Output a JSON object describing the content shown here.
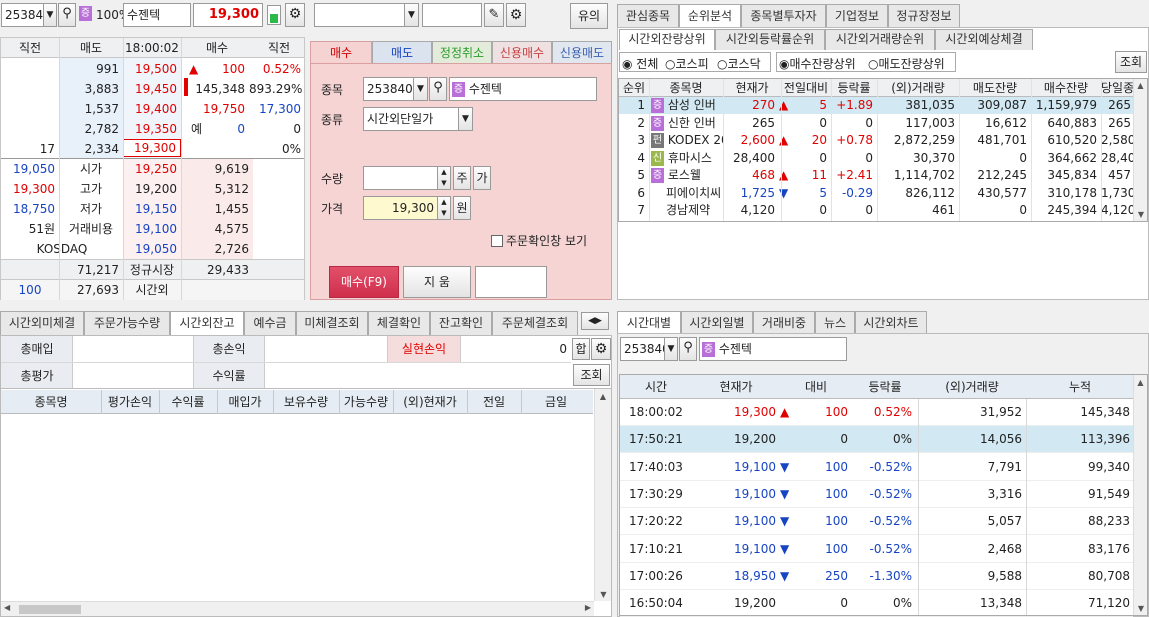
{
  "quote": {
    "code": "253840",
    "badge": "증",
    "zoom": "100%",
    "name": "수젠텍",
    "price": "19,300"
  },
  "order_top": {
    "notice_button": "유의"
  },
  "orderbook": {
    "headers": [
      "직전",
      "매도",
      "18:00:02",
      "매수",
      "직전"
    ],
    "asks": [
      {
        "qty": "991",
        "price": "19,500"
      },
      {
        "qty": "3,883",
        "price": "19,450"
      },
      {
        "qty": "1,537",
        "price": "19,400"
      },
      {
        "qty": "2,782",
        "price": "19,350"
      },
      {
        "prev": "17",
        "qty": "2,334",
        "price": "19,300"
      }
    ],
    "side_info": [
      {
        "arrow": "▲",
        "val": "100",
        "pct": "0.52%"
      },
      {
        "val": "145,348",
        "pct": "893.29%"
      },
      {
        "val": "19,750",
        "pct": "17,300"
      },
      {
        "label": "예",
        "val": "0",
        "pct": "0"
      },
      {
        "pct": "0%"
      }
    ],
    "bids": [
      {
        "price": "19,250",
        "qty": "9,619"
      },
      {
        "price": "19,200",
        "qty": "5,312"
      },
      {
        "price": "19,150",
        "qty": "1,455"
      },
      {
        "price": "19,100",
        "qty": "4,575"
      },
      {
        "price": "19,050",
        "qty": "2,726"
      }
    ],
    "left_info": [
      {
        "val": "19,050",
        "label": "시가"
      },
      {
        "val": "19,300",
        "label": "고가"
      },
      {
        "val": "18,750",
        "label": "저가"
      },
      {
        "val": "51원",
        "label": "거래비용"
      },
      {
        "val": "",
        "label": "KOSDAQ"
      }
    ],
    "total_ask": "71,217",
    "session": "정규시장",
    "total_bid": "29,433",
    "after_left": "100",
    "after_ask": "27,693",
    "after_label": "시간외"
  },
  "order_form": {
    "tabs": [
      "매수",
      "매도",
      "정정취소",
      "신용매수",
      "신용매도"
    ],
    "labels": {
      "stock": "종목",
      "kind": "종류",
      "qty": "수량",
      "price": "가격"
    },
    "code": "253840",
    "badge": "증",
    "name": "수젠텍",
    "kind": "시간외단일가",
    "price": "19,300",
    "unit_share": "주",
    "unit_ga": "가",
    "unit_won": "원",
    "confirm_label": "주문확인창 보기",
    "buy_button": "매수(F9)",
    "clear_button": "지 움"
  },
  "bottom_left": {
    "tabs": [
      "시간외미체결",
      "주문가능수량",
      "시간외잔고",
      "예수금",
      "미체결조회",
      "체결확인",
      "잔고확인",
      "주문체결조회"
    ],
    "labels": {
      "total_buy": "총매입",
      "total_eval": "총평가",
      "total_pl": "총손익",
      "profit_rate": "수익률",
      "realized": "실현손익"
    },
    "realized_value": "0",
    "sum_button": "합",
    "query_button": "조회",
    "columns": [
      "종목명",
      "평가손익",
      "수익률",
      "매입가",
      "보유수량",
      "가능수량",
      "(외)현재가",
      "전일",
      "금일"
    ]
  },
  "ranking": {
    "tabs": [
      "관심종목",
      "순위분석",
      "종목별투자자",
      "기업정보",
      "정규장정보"
    ],
    "subtabs": [
      "시간외잔량상위",
      "시간외등락률순위",
      "시간외거래량순위",
      "시간외예상체결"
    ],
    "market_filters": [
      "전체",
      "코스피",
      "코스닥"
    ],
    "sort_filters": [
      "매수잔량상위",
      "매도잔량상위"
    ],
    "query_button": "조회",
    "columns": [
      "순위",
      "종목명",
      "현재가",
      "전일대비",
      "등락률",
      "(외)거래량",
      "매도잔량",
      "매수잔량",
      "당일종가"
    ],
    "rows": [
      {
        "rank": "1",
        "badge": "증",
        "name": "삼성 인버",
        "price": "270",
        "arrow": "▲",
        "change": "5",
        "rate": "+1.89",
        "volume": "381,035",
        "ask": "309,087",
        "bid": "1,159,979",
        "close": "265",
        "color": "r",
        "selected": true
      },
      {
        "rank": "2",
        "badge": "증",
        "name": "신한 인버",
        "price": "265",
        "arrow": "",
        "change": "0",
        "rate": "0",
        "volume": "117,003",
        "ask": "16,612",
        "bid": "640,883",
        "close": "265",
        "color": ""
      },
      {
        "rank": "3",
        "badge": "펀",
        "name": "KODEX 200",
        "price": "2,600",
        "arrow": "▲",
        "change": "20",
        "rate": "+0.78",
        "volume": "2,872,259",
        "ask": "481,701",
        "bid": "610,520",
        "close": "2,580",
        "color": "r"
      },
      {
        "rank": "4",
        "badge": "신",
        "name": "휴마시스",
        "price": "28,400",
        "arrow": "",
        "change": "0",
        "rate": "0",
        "volume": "30,370",
        "ask": "0",
        "bid": "364,662",
        "close": "28,400",
        "color": ""
      },
      {
        "rank": "5",
        "badge": "증",
        "name": "로스웰",
        "price": "468",
        "arrow": "▲",
        "change": "11",
        "rate": "+2.41",
        "volume": "1,114,702",
        "ask": "212,245",
        "bid": "345,834",
        "close": "457",
        "color": "r"
      },
      {
        "rank": "6",
        "badge": "",
        "name": "피에이치씨",
        "price": "1,725",
        "arrow": "▼",
        "change": "5",
        "rate": "-0.29",
        "volume": "826,112",
        "ask": "430,577",
        "bid": "310,178",
        "close": "1,730",
        "color": "b"
      },
      {
        "rank": "7",
        "badge": "",
        "name": "경남제약",
        "price": "4,120",
        "arrow": "",
        "change": "0",
        "rate": "0",
        "volume": "461",
        "ask": "0",
        "bid": "245,394",
        "close": "4,120",
        "color": ""
      }
    ]
  },
  "time_panel": {
    "tabs": [
      "시간대별",
      "시간외일별",
      "거래비중",
      "뉴스",
      "시간외차트"
    ],
    "code": "253840",
    "badge": "증",
    "name": "수젠텍",
    "columns": [
      "시간",
      "현재가",
      "대비",
      "등락률",
      "(외)거래량",
      "누적"
    ],
    "rows": [
      {
        "time": "18:00:02",
        "price": "19,300",
        "arrow": "▲",
        "diff": "100",
        "rate": "0.52%",
        "volume": "31,952",
        "cum": "145,348",
        "color": "r"
      },
      {
        "time": "17:50:21",
        "price": "19,200",
        "arrow": "",
        "diff": "0",
        "rate": "0%",
        "volume": "14,056",
        "cum": "113,396",
        "color": "",
        "selected": true
      },
      {
        "time": "17:40:03",
        "price": "19,100",
        "arrow": "▼",
        "diff": "100",
        "rate": "-0.52%",
        "volume": "7,791",
        "cum": "99,340",
        "color": "b"
      },
      {
        "time": "17:30:29",
        "price": "19,100",
        "arrow": "▼",
        "diff": "100",
        "rate": "-0.52%",
        "volume": "3,316",
        "cum": "91,549",
        "color": "b"
      },
      {
        "time": "17:20:22",
        "price": "19,100",
        "arrow": "▼",
        "diff": "100",
        "rate": "-0.52%",
        "volume": "5,057",
        "cum": "88,233",
        "color": "b"
      },
      {
        "time": "17:10:21",
        "price": "19,100",
        "arrow": "▼",
        "diff": "100",
        "rate": "-0.52%",
        "volume": "2,468",
        "cum": "83,176",
        "color": "b"
      },
      {
        "time": "17:00:26",
        "price": "18,950",
        "arrow": "▼",
        "diff": "250",
        "rate": "-1.30%",
        "volume": "9,588",
        "cum": "80,708",
        "color": "b"
      },
      {
        "time": "16:50:04",
        "price": "19,200",
        "arrow": "",
        "diff": "0",
        "rate": "0%",
        "volume": "13,348",
        "cum": "71,120",
        "color": ""
      }
    ]
  }
}
